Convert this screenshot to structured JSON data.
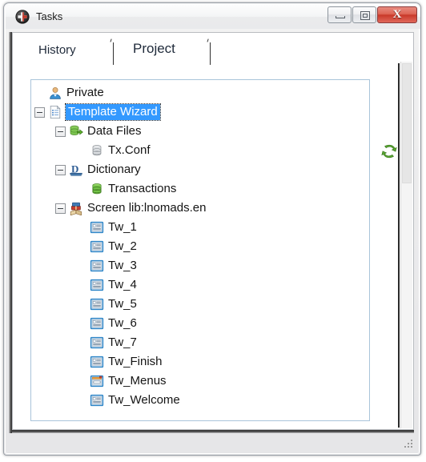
{
  "window": {
    "title": "Tasks",
    "icon": "tasks-app-icon",
    "controls": {
      "minimize_label": "Minimize",
      "maximize_label": "Maximize",
      "close_label": "Close",
      "close_glyph": "X"
    }
  },
  "tabs": [
    {
      "label": "History",
      "selected": false
    },
    {
      "label": "Project",
      "selected": true
    }
  ],
  "toolbar": {
    "refresh_label": "Refresh",
    "refresh_icon": "refresh-icon"
  },
  "colors": {
    "selection_bg": "#3399ff",
    "selection_fg": "#ffffff",
    "panel_border": "#a9c4da",
    "close_button": "#c9392a",
    "accent_green": "#63ad38"
  },
  "tree": {
    "nodes": [
      {
        "label": "Private",
        "depth": 0,
        "icon": "user-icon",
        "expander": "none",
        "selected": false
      },
      {
        "label": "Template Wizard",
        "depth": 0,
        "icon": "document-list-icon",
        "expander": "minus",
        "selected": true
      },
      {
        "label": "Data Files",
        "depth": 1,
        "icon": "database-export-icon",
        "expander": "minus",
        "selected": false
      },
      {
        "label": "Tx.Conf",
        "depth": 2,
        "icon": "database-gray-icon",
        "expander": "none",
        "selected": false
      },
      {
        "label": "Dictionary",
        "depth": 1,
        "icon": "dictionary-d-icon",
        "expander": "minus",
        "selected": false
      },
      {
        "label": "Transactions",
        "depth": 2,
        "icon": "database-green-icon",
        "expander": "none",
        "selected": false
      },
      {
        "label": "Screen lib:lnomads.en",
        "depth": 1,
        "icon": "books-icon",
        "expander": "minus",
        "selected": false
      },
      {
        "label": "Tw_1",
        "depth": 2,
        "icon": "screen-form-icon",
        "expander": "none",
        "selected": false
      },
      {
        "label": "Tw_2",
        "depth": 2,
        "icon": "screen-form-icon",
        "expander": "none",
        "selected": false
      },
      {
        "label": "Tw_3",
        "depth": 2,
        "icon": "screen-form-icon",
        "expander": "none",
        "selected": false
      },
      {
        "label": "Tw_4",
        "depth": 2,
        "icon": "screen-form-icon",
        "expander": "none",
        "selected": false
      },
      {
        "label": "Tw_5",
        "depth": 2,
        "icon": "screen-form-icon",
        "expander": "none",
        "selected": false
      },
      {
        "label": "Tw_6",
        "depth": 2,
        "icon": "screen-form-icon",
        "expander": "none",
        "selected": false
      },
      {
        "label": "Tw_7",
        "depth": 2,
        "icon": "screen-form-icon",
        "expander": "none",
        "selected": false
      },
      {
        "label": "Tw_Finish",
        "depth": 2,
        "icon": "screen-form-icon",
        "expander": "none",
        "selected": false
      },
      {
        "label": "Tw_Menus",
        "depth": 2,
        "icon": "screen-menu-icon",
        "expander": "none",
        "selected": false
      },
      {
        "label": "Tw_Welcome",
        "depth": 2,
        "icon": "screen-form-icon",
        "expander": "none",
        "selected": false
      }
    ]
  },
  "statusbar": {
    "resize_grip": "resize-grip"
  }
}
